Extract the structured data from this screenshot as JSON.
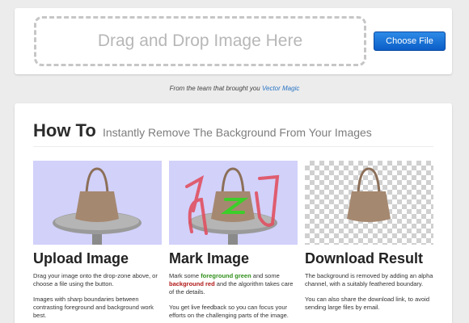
{
  "upload": {
    "dropzone_label": "Drag and Drop Image Here",
    "choose_button": "Choose File"
  },
  "credit": {
    "prefix": "From the team that brought you",
    "link": "Vector Magic"
  },
  "howto": {
    "title": "How To",
    "subtitle": "Instantly Remove The Background From Your Images",
    "steps": [
      {
        "title": "Upload Image",
        "p1": "Drag your image onto the drop-zone above, or choose a file using the button.",
        "p2": "Images with sharp boundaries between contrasting foreground and background work best."
      },
      {
        "title": "Mark Image",
        "p1_a": "Mark some",
        "p1_green": "foreground green",
        "p1_b": "and some",
        "p1_red": "background red",
        "p1_c": "and the algorithm takes care of the details.",
        "p2": "You get live feedback so you can focus your efforts on the challenging parts of the image."
      },
      {
        "title": "Download Result",
        "p1": "The background is removed by adding an alpha channel, with a suitably feathered boundary.",
        "p2": "You can also share the download link, to avoid sending large files by email."
      }
    ]
  },
  "colors": {
    "button": "#0b5ec8",
    "link": "#2a74c5",
    "foreground_mark": "#2f8f1a",
    "background_mark": "#b01616",
    "panel_bg": "#d1d1fa",
    "bag": "#a58870"
  },
  "icons": {
    "panel_image": "handbag-on-table"
  }
}
